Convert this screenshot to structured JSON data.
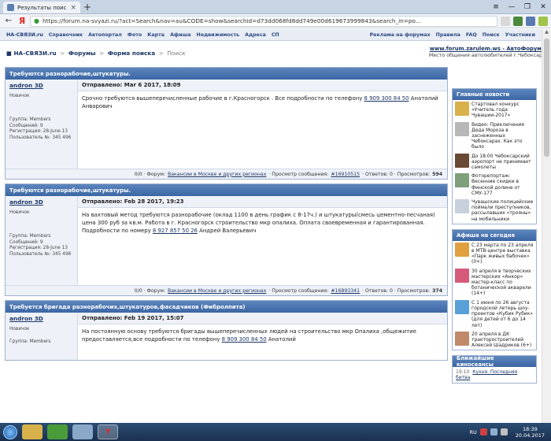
{
  "browser": {
    "tab_title": "Результаты поиска",
    "tab_close": "×",
    "new_tab": "+",
    "url": "https://forum.na-svyazi.ru/?act=Search&nav=au&CODE=show&searchid=d73dd068fd8dd749e00d619673999843&search_in=po...",
    "yandex_logo": "Я",
    "back": "←",
    "window_controls": [
      "—",
      "❐",
      "✕"
    ],
    "menu": "≡"
  },
  "site_nav": {
    "brand": "НА-СВЯЗИ.ru",
    "left_items": [
      "Справочник",
      "Автопортал",
      "Фото",
      "Карта",
      "Афиша",
      "Недвижимость",
      "Адреса",
      "СП"
    ],
    "right_items": [
      "Реклама на форумах",
      "Правила",
      "FAQ",
      "Поиск",
      "Участники"
    ]
  },
  "breadcrumbs": {
    "items": [
      "НА-СВЯЗИ.ru",
      "Форумы",
      "Форма поиска"
    ],
    "current": "Поиск",
    "sep": ">"
  },
  "site_link": {
    "url": "www.forum.zarulem.ws - АвтоФорумы",
    "desc": "Место общения автолюбителей г.Чебоксары"
  },
  "posts": [
    {
      "title": "Требуются разнорабочие,штукатуры.",
      "author": "andron 3D",
      "date": "Отправлено: Mar 6 2017, 18:09",
      "text": "Срочно требуются вышеперечисленные рабочие в г.Красногорск . Все подробности по телефону",
      "phone": "8 909 300 84 50",
      "text_after": "Анатолий Анварович",
      "rank": "Новичок",
      "group": "Группа: Members",
      "messages": "Сообщений: 9",
      "registered": "Регистрация: 28-June 13",
      "user_no": "Пользователь №: 345 496",
      "foot_prefix": "0/0 · Форум:",
      "forum": "Вакансии в Москве и других регионах",
      "foot_view": "· Просмотр сообщения:",
      "msg_id": "#16910515",
      "foot_rest": "· Ответов: 0 · Просмотров:",
      "views": "594"
    },
    {
      "title": "Требуются разнорабочие,штукатуры.",
      "author": "andron 3D",
      "date": "Отправлено: Feb 28 2017, 19:23",
      "text": "На вахтовый метод требуются разнорабочие (оклад 1100 в день график с 8-17ч.) и штукатуры(смесь цементно-песчаная) цена 300 руб за кв.м. Работа в г. Красногорск строительство мкр опалиха. Оплата своевременная и гарантированная. Подробности по номеру",
      "phone": "8 927 857 50 26",
      "text_after": "Андрей Валерьевич",
      "rank": "Новичок",
      "group": "Группа: Members",
      "messages": "Сообщений: 9",
      "registered": "Регистрация: 28-June 13",
      "user_no": "Пользователь №: 345 496",
      "foot_prefix": "0/0 · Форум:",
      "forum": "Вакансии в Москве и других регионах",
      "foot_view": "· Просмотр сообщения:",
      "msg_id": "#16893341",
      "foot_rest": "· Ответов: 0 · Просмотров:",
      "views": "374"
    },
    {
      "title": "Требуется бригада разнорабочих,штукатуров,фасадчиков (Фибролпита)",
      "author": "andron 3D",
      "date": "Отправлено: Feb 19 2017, 15:07",
      "text": "На постоянную основу требуются бригады вышеперечисленных людей на строительство мкр Опалиха ,общежитие предоставляется,все подробности по телефону",
      "phone": "8 909 300 84 50",
      "text_after": "Анатолий",
      "rank": "Новичок",
      "group": "Группа: Members"
    }
  ],
  "sidebar": {
    "news_title": "Главные новости",
    "news": [
      {
        "text": "Стартовал конкурс «Учитель года Чувашии-2017»",
        "color": "#d9b04a"
      },
      {
        "text": "Видео: Приключения Деда Мороза в заснеженных Чебоксарах. Как это было",
        "color": "#b7b7b7"
      },
      {
        "text": "До 18:00 Чебоксарский аэропорт не принимает самолеты",
        "color": "#6a4a34"
      },
      {
        "text": "Фоторепортаж: Весенние скидки в Финской долине от СМУ-177",
        "color": "#7fa07a"
      },
      {
        "text": "Чувашские полицейские поймали преступников, рассылавших «трояны» на мобильники",
        "color": "#c8d0dc"
      }
    ],
    "afisha_title": "Афиша на сегодня",
    "afisha": [
      {
        "text": "С 23 марта по 23 апреля в МТВ-центре выставка «Парк живых бабочек» (0+)",
        "color": "#e0a040"
      },
      {
        "text": "30 апреля в творческих мастерских «Анкор» мастер-класс по ботанической акварели (14+)",
        "color": "#d65a7a"
      },
      {
        "text": "С 1 июня по 26 августа городской летерь шоу-проектов «Кубик Рубик» (для детей от 6 до 14 лет)",
        "color": "#5aa0d8"
      },
      {
        "text": "20 апреля в ДК тракторостроителей Алексей Шадриков (6+)",
        "color": "#c08a6a"
      }
    ],
    "cinema_title": "Ближайшие киносеансы",
    "cinema": [
      {
        "time": "19:10",
        "title": "Кухня. Последняя битва"
      }
    ]
  },
  "taskbar": {
    "lang": "RU",
    "time": "18:39",
    "date": "20.04.2017",
    "yandex": "Y"
  }
}
